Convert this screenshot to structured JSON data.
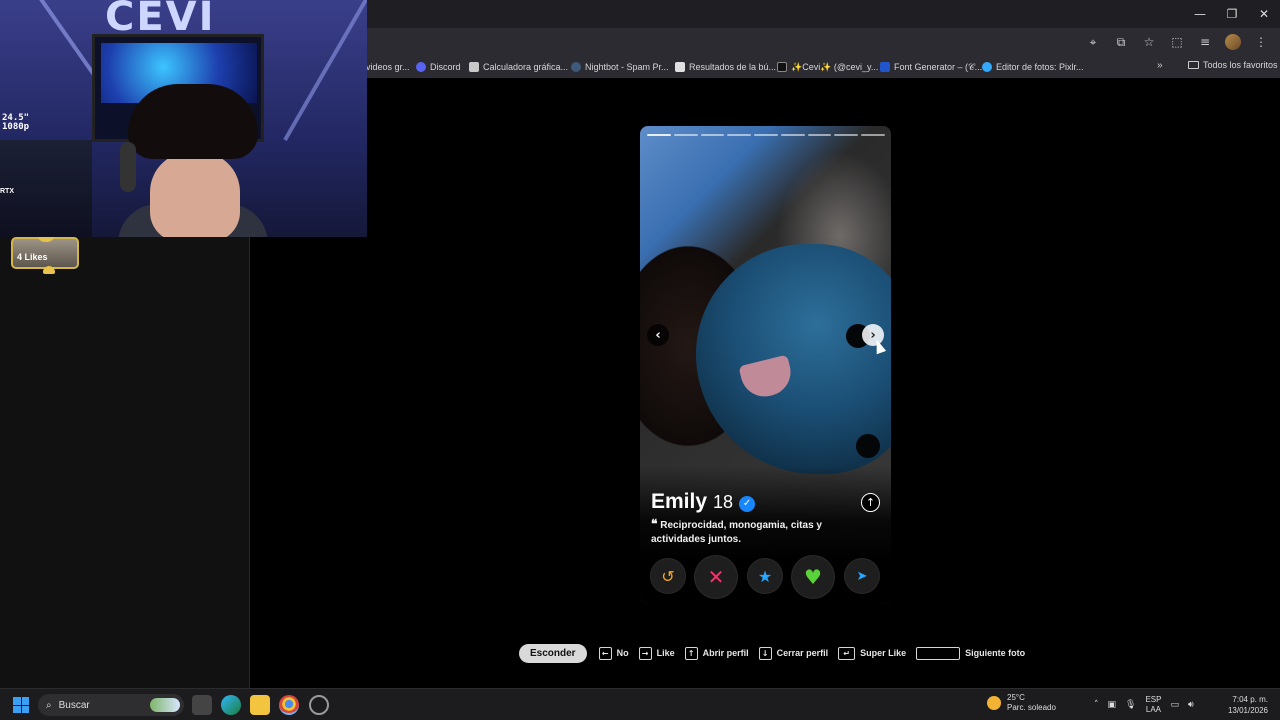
{
  "window": {
    "minimize": "—",
    "maximize": "❐",
    "close": "✕"
  },
  "toolbar": {
    "icons": [
      "location-icon",
      "install-icon",
      "star-icon",
      "extensions-icon",
      "media-icon",
      "profile-avatar",
      "menu-icon"
    ]
  },
  "bookmarks": {
    "items": [
      {
        "label": "videos gr...",
        "icon_color": "#8a8a8a"
      },
      {
        "label": "Discord",
        "icon_color": "#5865f2"
      },
      {
        "label": "Calculadora gráfica...",
        "icon_color": "#c9c9c9"
      },
      {
        "label": "Nightbot - Spam Pr...",
        "icon_color": "#3d5a7a"
      },
      {
        "label": "Resultados de la bú...",
        "icon_color": "#e0e0e0"
      },
      {
        "label": "✨Cevi✨ (@cevi_y...",
        "icon_color": "#111111"
      },
      {
        "label": "Font Generator – (𝒞...",
        "icon_color": "#2255cc"
      },
      {
        "label": "Editor de fotos: Pixlr...",
        "icon_color": "#33aaff"
      }
    ],
    "more": "»",
    "all_favorites": "Todos los favoritos"
  },
  "webcam": {
    "logo": "CEVI",
    "overlay_text": "24.5\"\n1080p",
    "tag": "RTX"
  },
  "sidebar": {
    "likes_label": "4 Likes"
  },
  "profile": {
    "name": "Emily",
    "age": "18",
    "verified_icon": "verified-badge-icon",
    "bio_quote": "❝",
    "bio": "Reciprocidad, monogamia, citas y actividades juntos.",
    "photo_count": 9,
    "current_photo": 1
  },
  "actions": [
    {
      "name": "rewind-button",
      "glyph": "↺",
      "color": "#f5a623"
    },
    {
      "name": "nope-button",
      "glyph": "✕",
      "color": "#ff2f6d"
    },
    {
      "name": "super-like-button",
      "glyph": "★",
      "color": "#2aa6ff"
    },
    {
      "name": "like-button",
      "glyph": "♥",
      "color": "#5bd23a"
    },
    {
      "name": "boost-button",
      "glyph": "➤",
      "color": "#2aa6ff"
    }
  ],
  "shortcuts": {
    "hide_label": "Esconder",
    "items": [
      {
        "key": "←",
        "label": "No"
      },
      {
        "key": "→",
        "label": "Like"
      },
      {
        "key": "↑",
        "label": "Abrir perfil"
      },
      {
        "key": "↓",
        "label": "Cerrar perfil"
      },
      {
        "key": "↵",
        "label": "Super Like"
      },
      {
        "key": "",
        "label": "Siguiente foto"
      }
    ]
  },
  "taskbar": {
    "search_placeholder": "Buscar",
    "weather_temp": "25°C",
    "weather_desc": "Parc. soleado",
    "lang_top": "ESP",
    "lang_bottom": "LAA",
    "time": "7:04 p. m.",
    "date": "13/01/2026"
  }
}
